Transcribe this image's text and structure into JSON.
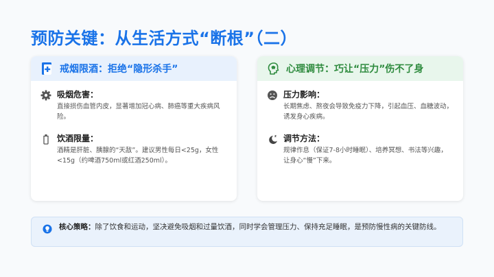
{
  "page": {
    "title": "预防关键：从生活方式“断根”（二）"
  },
  "left_card": {
    "title": "戒烟限酒：拒绝“隐形杀手”",
    "icon": "hospital-cross-icon",
    "items": [
      {
        "icon": "gear-icon",
        "title": "吸烟危害：",
        "text": "直接损伤血管内皮，显著增加冠心病、肺癌等重大疾病风险。"
      },
      {
        "icon": "bottle-icon",
        "title": "饮酒限量：",
        "text": "酒精是肝脏、胰腺的“天敌”。建议男性每日<25g，女性<15g（约啤酒750ml或红酒250ml）。"
      }
    ]
  },
  "right_card": {
    "title": "心理调节：巧让“压力”伤不了身",
    "icon": "head-mind-icon",
    "items": [
      {
        "icon": "sad-face-icon",
        "title": "压力影响：",
        "text": "长期焦虑、熬夜会导致免疫力下降，引起血压、血糖波动，诱发身心疾病。"
      },
      {
        "icon": "moon-sleep-icon",
        "title": "调节方法：",
        "text": "规律作息（保证7-8小时睡眠）、培养冥想、书法等兴趣，让身心“慢”下来。"
      }
    ]
  },
  "strategy": {
    "icon": "lightbulb-icon",
    "label": "核心策略：",
    "text": "除了饮食和运动，坚决避免吸烟和过量饮酒，同时学会管理压力、保持充足睡眠，是预防慢性病的关键防线。"
  },
  "colors": {
    "accent_blue": "#1a73e8",
    "accent_green": "#2e8b3e",
    "left_head_bg": "#e8f1fd",
    "right_head_bg": "#e8f6ec"
  }
}
